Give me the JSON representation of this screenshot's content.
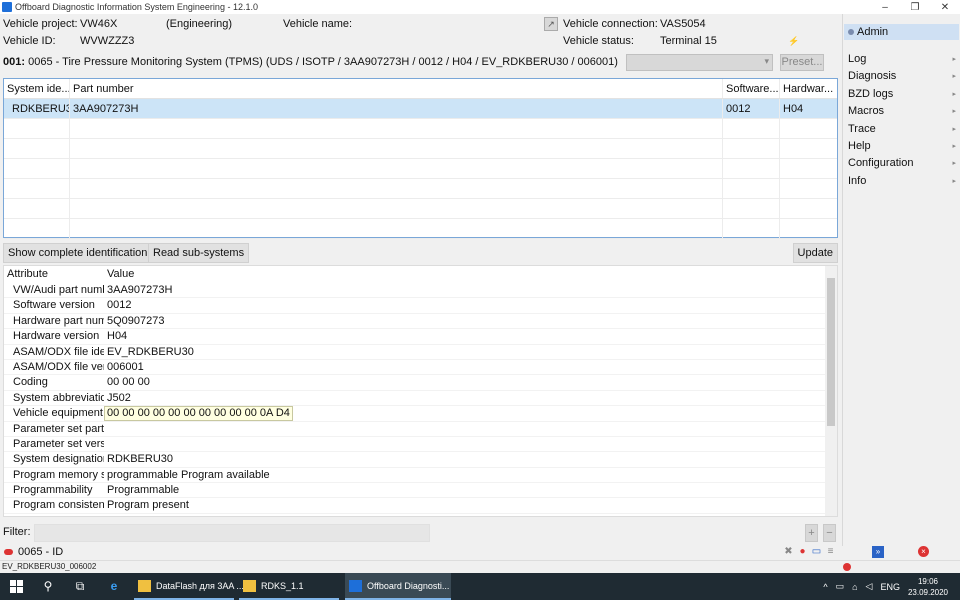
{
  "window": {
    "title": "Offboard Diagnostic Information System Engineering - 12.1.0",
    "controls": [
      "–",
      "❐",
      "✕"
    ]
  },
  "header": {
    "vehicle_project_label": "Vehicle project:",
    "vehicle_project_value": "VW46X",
    "mode": "(Engineering)",
    "vehicle_name_label": "Vehicle name:",
    "vehicle_name_value": "",
    "vehicle_id_label": "Vehicle ID:",
    "vehicle_id_value": "WVWZZZ3",
    "vehicle_connection_label": "Vehicle connection:",
    "vehicle_connection_value": "VAS5054",
    "vehicle_status_label": "Vehicle status:",
    "vehicle_status_value": "Terminal 15"
  },
  "system_bar": {
    "index": "001:",
    "description": "0065 - Tire Pressure Monitoring System (TPMS)  (UDS / ISOTP / 3AA907273H / 0012 / H04 / EV_RDKBERU30 / 006001)",
    "dropdown_value": "",
    "preset_label": "Preset..."
  },
  "top_table": {
    "columns": [
      "System ide...",
      "Part number",
      "Software...",
      "Hardwar..."
    ],
    "rows": [
      [
        "RDKBERU3",
        "3AA907273H",
        "0012",
        "H04"
      ]
    ]
  },
  "buttons": {
    "show_complete": "Show complete identification",
    "read_subsystems": "Read sub-systems",
    "update": "Update"
  },
  "attr_table": {
    "columns": [
      "Attribute",
      "Value"
    ],
    "rows": [
      [
        "VW/Audi part numb",
        "3AA907273H"
      ],
      [
        "Software version",
        "0012"
      ],
      [
        "Hardware part num",
        "5Q0907273"
      ],
      [
        "Hardware version",
        "H04"
      ],
      [
        "ASAM/ODX file iden",
        "EV_RDKBERU30"
      ],
      [
        "ASAM/ODX file ver",
        "006001"
      ],
      [
        "Coding",
        "00 00 00"
      ],
      [
        "System abbreviatio",
        "J502"
      ],
      [
        "Vehicle equipment",
        "00 00 00 00 00 00 00 00 00 00 0A D4"
      ],
      [
        "Parameter set part",
        ""
      ],
      [
        "Parameter set vers",
        ""
      ],
      [
        "System designation",
        "RDKBERU30"
      ],
      [
        "Program memory s",
        "programmable Program available"
      ],
      [
        "Programmability",
        "Programmable"
      ],
      [
        "Program consistenc",
        "Program present"
      ]
    ]
  },
  "filter": {
    "label": "Filter:",
    "value": "",
    "plus": "+",
    "minus": "−"
  },
  "status_tab": {
    "label": "0065 - ID"
  },
  "right_panel": {
    "user": "Admin",
    "menu": [
      "Log",
      "Diagnosis",
      "BZD logs",
      "Macros",
      "Trace",
      "Help",
      "Configuration",
      "Info"
    ]
  },
  "bottom_status": {
    "text": "EV_RDKBERU30_006002"
  },
  "taskbar": {
    "tasks": [
      "DataFlash для 3AA ...",
      "RDKS_1.1",
      "Offboard Diagnosti..."
    ],
    "language": "ENG",
    "time": "19:06",
    "date": "23.09.2020"
  }
}
